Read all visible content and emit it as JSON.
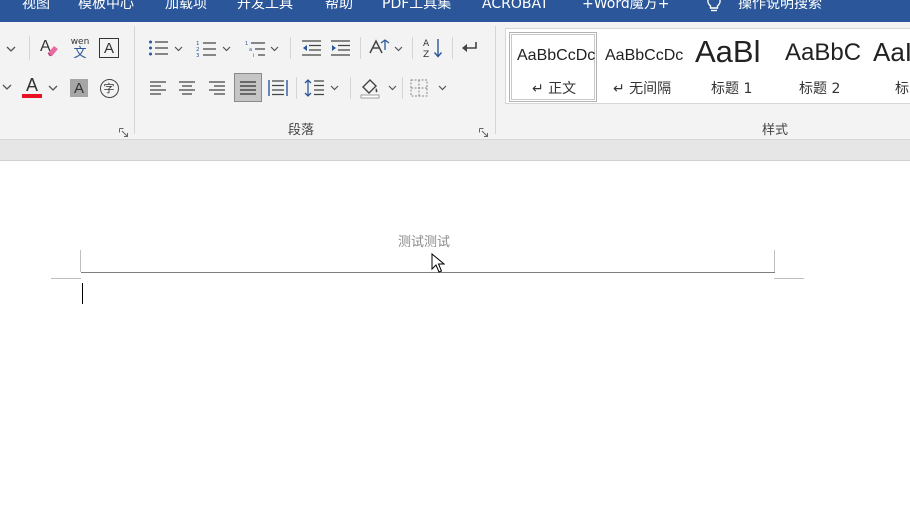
{
  "menubar": {
    "items": [
      "视图",
      "模板中心",
      "加载项",
      "开发工具",
      "帮助",
      "PDF工具集",
      "ACROBAT",
      "+Word魔方+"
    ],
    "search": "操作说明搜索"
  },
  "ribbon": {
    "font_group": {
      "clear_format_icon": "eraser-icon",
      "phonetic_guide_icon": "wen",
      "phonetic_guide_char": "文",
      "char_border_letter": "A",
      "font_color_letter": "A",
      "char_shading_letter": "A",
      "enclose_char": "字",
      "font_color": "#e81123"
    },
    "paragraph_group": {
      "label": "段落"
    },
    "styles_group": {
      "label": "样式",
      "styles": [
        {
          "sample": "AaBbCcDc",
          "name": "↵ 正文",
          "selected": true
        },
        {
          "sample": "AaBbCcDc",
          "name": "↵ 无间隔",
          "selected": false
        },
        {
          "sample": "AaBl",
          "name": "标题 1",
          "selected": false
        },
        {
          "sample": "AaBbC",
          "name": "标题 2",
          "selected": false
        },
        {
          "sample": "AaI",
          "name": "标",
          "selected": false
        }
      ]
    }
  },
  "document": {
    "header_text": "测试测试"
  }
}
